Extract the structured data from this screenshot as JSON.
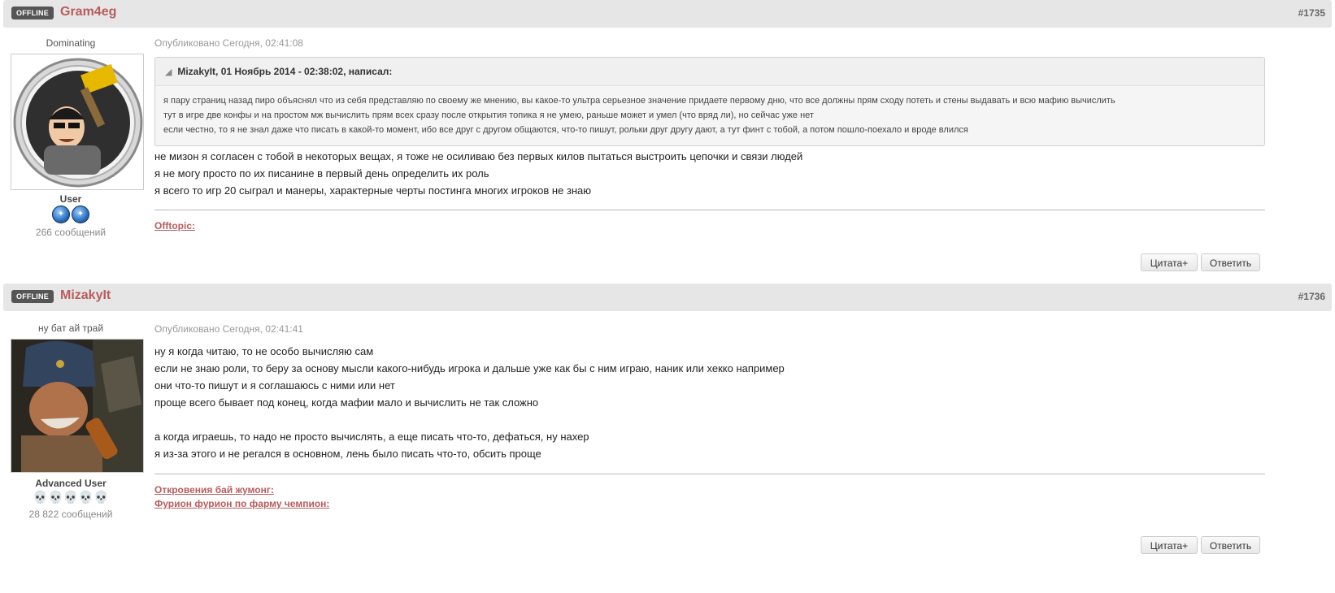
{
  "posts": [
    {
      "status_badge": "OFFLINE",
      "username": "Gram4eg",
      "post_number": "#1735",
      "user_title": "Dominating",
      "rank": "User",
      "rank_pip_icon": "blue-orb-icon",
      "post_count": "266 сообщений",
      "published": "Опубликовано Сегодня, 02:41:08",
      "quote": {
        "header": "MizakyIt, 01 Ноябрь 2014 - 02:38:02, написал:",
        "lines": [
          "я пару страниц назад пиро объяснял что из себя представляю по своему же мнению, вы какое-то ультра серьезное значение придаете первому дню, что все должны прям сходу потеть и стены выдавать и всю мафию вычислить",
          "тут в игре две конфы и на простом мж вычислить прям всех сразу после открытия топика я не умею, раньше может и умел (что вряд ли), но сейчас уже нет",
          "если честно, то я не знал даже что писать в какой-то момент, ибо все друг с другом общаются, что-то пишут, рольки друг другу дают, а тут финт с тобой, а потом пошло-поехало и вроде влился"
        ]
      },
      "body_lines": [
        "не мизон я согласен с тобой в некоторых вещах, я тоже не осиливаю без первых килов пытаться выстроить цепочки и связи людей",
        "я не могу просто по их писанине в первый день определить их роль",
        "я всего то игр 20 сыграл и манеры, характерные черты постинга многих игроков не знаю"
      ],
      "signature_links": [
        "Offtopic:"
      ],
      "buttons": {
        "quote": "Цитата+",
        "reply": "Ответить"
      }
    },
    {
      "status_badge": "OFFLINE",
      "username": "MizakyIt",
      "post_number": "#1736",
      "user_title": "ну бат ай трай",
      "rank": "Advanced User",
      "rank_pip_icon": "skull-icon",
      "post_count": "28 822 сообщений",
      "published": "Опубликовано Сегодня, 02:41:41",
      "body_lines": [
        "ну я когда читаю, то не особо вычисляю сам",
        "если не знаю роли, то беру за основу мысли какого-нибудь игрока и дальше уже как бы с ним играю, наник или хекко например",
        "они что-то пишут и я соглашаюсь с ними или нет",
        "проще всего бывает под конец, когда мафии мало и вычислить не так сложно",
        "",
        "а когда играешь, то надо не просто вычислять, а еще писать что-то, дефаться, ну нахер",
        "я из-за этого и не регался в основном, лень было писать что-то, обсить проще"
      ],
      "signature_links": [
        "Откровения бай жумонг:",
        "Фурион фурион по фарму чемпион:"
      ],
      "buttons": {
        "quote": "Цитата+",
        "reply": "Ответить"
      }
    }
  ],
  "colors": {
    "accent": "#b85c5c",
    "header_bg": "#e6e6e6",
    "badge_bg": "#555555"
  }
}
